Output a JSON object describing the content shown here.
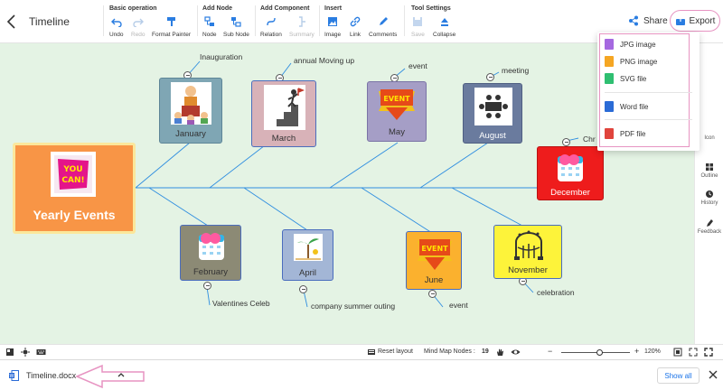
{
  "header": {
    "title": "Timeline",
    "share_label": "Share",
    "export_label": "Export"
  },
  "toolbar": {
    "groups": [
      {
        "title": "Basic operation",
        "buttons": [
          {
            "label": "Undo",
            "icon": "undo-icon",
            "enabled": true
          },
          {
            "label": "Redo",
            "icon": "redo-icon",
            "enabled": false
          },
          {
            "label": "Format Painter",
            "icon": "format-painter-icon",
            "enabled": true
          }
        ]
      },
      {
        "title": "Add Node",
        "buttons": [
          {
            "label": "Node",
            "icon": "node-icon",
            "enabled": true
          },
          {
            "label": "Sub Node",
            "icon": "sub-node-icon",
            "enabled": true
          }
        ]
      },
      {
        "title": "Add Component",
        "buttons": [
          {
            "label": "Relation",
            "icon": "relation-icon",
            "enabled": true
          },
          {
            "label": "Summary",
            "icon": "summary-icon",
            "enabled": false
          }
        ]
      },
      {
        "title": "Insert",
        "buttons": [
          {
            "label": "Image",
            "icon": "image-icon",
            "enabled": true
          },
          {
            "label": "Link",
            "icon": "link-icon",
            "enabled": true
          },
          {
            "label": "Comments",
            "icon": "comments-icon",
            "enabled": true
          }
        ]
      },
      {
        "title": "Tool Settings",
        "buttons": [
          {
            "label": "Save",
            "icon": "save-icon",
            "enabled": false
          },
          {
            "label": "Collapse",
            "icon": "collapse-icon",
            "enabled": true
          }
        ]
      }
    ]
  },
  "export_menu": {
    "items": [
      {
        "label": "JPG image",
        "icon": "jpg-file-icon",
        "color": "#a569e0"
      },
      {
        "label": "PNG image",
        "icon": "png-file-icon",
        "color": "#f5a623"
      },
      {
        "label": "SVG file",
        "icon": "svg-file-icon",
        "color": "#2fbf71"
      },
      {
        "label": "Word file",
        "icon": "word-file-icon",
        "color": "#2b6bd6"
      },
      {
        "label": "PDF file",
        "icon": "pdf-file-icon",
        "color": "#e0443c"
      }
    ]
  },
  "mindmap": {
    "root": {
      "label": "Yearly Events",
      "image_text": "YOU CAN!"
    },
    "nodes": [
      {
        "id": "january",
        "label": "January",
        "event": "Inauguration",
        "color": "#7fa6b4"
      },
      {
        "id": "march",
        "label": "March",
        "event": "annual Moving up",
        "color": "#d8b2b8"
      },
      {
        "id": "may",
        "label": "May",
        "event": "event",
        "color": "#a59ec6"
      },
      {
        "id": "august",
        "label": "August",
        "event": "meeting",
        "color": "#6a7b9e"
      },
      {
        "id": "december",
        "label": "December",
        "event": "Chr",
        "color": "#ee1c1c"
      },
      {
        "id": "february",
        "label": "February",
        "event": "Valentines Celeb",
        "color": "#8c8a75"
      },
      {
        "id": "april",
        "label": "April",
        "event": "company summer outing",
        "color": "#a3b6d6"
      },
      {
        "id": "june",
        "label": "June",
        "event": "event",
        "color": "#fbb12e"
      },
      {
        "id": "november",
        "label": "November",
        "event": "celebration",
        "color": "#fdf33a"
      }
    ],
    "badge_text": "EVENT"
  },
  "sidebar": {
    "items": [
      {
        "label": "Icon",
        "icon": "icon-panel-icon"
      },
      {
        "label": "Outline",
        "icon": "outline-icon"
      },
      {
        "label": "History",
        "icon": "history-icon"
      },
      {
        "label": "Feedback",
        "icon": "feedback-icon"
      }
    ]
  },
  "statusbar": {
    "reset_label": "Reset layout",
    "nodes_label": "Mind Map Nodes :",
    "nodes_count": "19",
    "zoom": "120%"
  },
  "download_bar": {
    "file_name": "Timeline.docx",
    "show_all_label": "Show all"
  },
  "colors": {
    "canvas_bg": "#e4f3e4",
    "accent": "#1a73e8",
    "highlight": "#e794c2",
    "line": "#2f8ee0"
  }
}
